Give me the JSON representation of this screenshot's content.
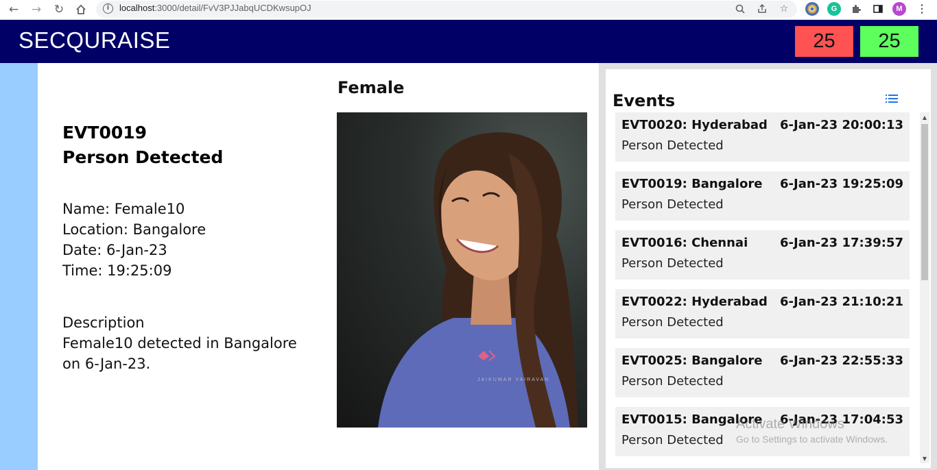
{
  "browser": {
    "url_host": "localhost",
    "url_path": ":3000/detail/FvV3PJJabqUCDKwsupOJ",
    "profile_initial": "M"
  },
  "header": {
    "brand": "SECQURAISE",
    "counter_red": "25",
    "counter_green": "25",
    "colors": {
      "bar": "#000066",
      "red": "#ff5252",
      "green": "#5cff5c"
    }
  },
  "detail": {
    "event_id": "EVT0019",
    "event_type": "Person Detected",
    "name_line": "Name: Female10",
    "location_line": "Location: Bangalore",
    "date_line": "Date: 6-Jan-23",
    "time_line": "Time: 19:25:09",
    "description_label": "Description",
    "description_text": "Female10 detected in Bangalore on 6-Jan-23.",
    "gender": "Female",
    "photo_credit": "JAIKUMAR VAIRAVAN"
  },
  "events": {
    "title": "Events",
    "items": [
      {
        "title": "EVT0020: Hyderabad",
        "timestamp": "6-Jan-23 20:00:13",
        "type": "Person Detected"
      },
      {
        "title": "EVT0019: Bangalore",
        "timestamp": "6-Jan-23 19:25:09",
        "type": "Person Detected"
      },
      {
        "title": "EVT0016: Chennai",
        "timestamp": "6-Jan-23 17:39:57",
        "type": "Person Detected"
      },
      {
        "title": "EVT0022: Hyderabad",
        "timestamp": "6-Jan-23 21:10:21",
        "type": "Person Detected"
      },
      {
        "title": "EVT0025: Bangalore",
        "timestamp": "6-Jan-23 22:55:33",
        "type": "Person Detected"
      },
      {
        "title": "EVT0015: Bangalore",
        "timestamp": "6-Jan-23 17:04:53",
        "type": "Person Detected"
      }
    ]
  },
  "watermark": {
    "line1": "Activate Windows",
    "line2": "Go to Settings to activate Windows."
  }
}
